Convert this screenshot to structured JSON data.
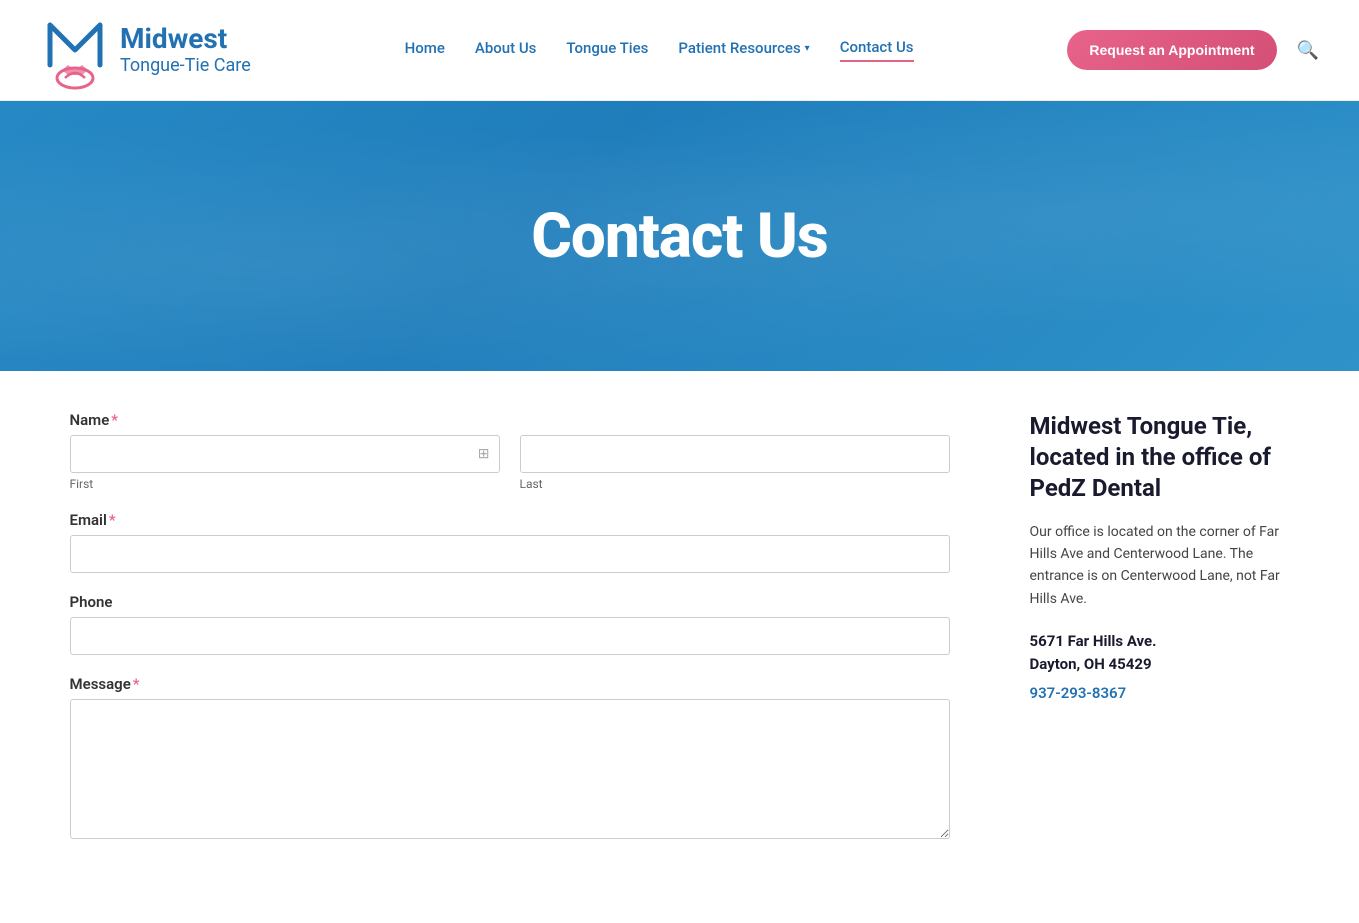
{
  "header": {
    "logo_title": "Midwest",
    "logo_subtitle": "Tongue-Tie Care",
    "request_btn_label": "Request an Appointment",
    "nav": {
      "home": "Home",
      "about_us": "About Us",
      "tongue_ties": "Tongue Ties",
      "patient_resources": "Patient Resources",
      "contact_us": "Contact Us"
    }
  },
  "hero": {
    "title": "Contact Us"
  },
  "form": {
    "name_label": "Name",
    "name_required": "*",
    "first_label": "First",
    "last_label": "Last",
    "email_label": "Email",
    "email_required": "*",
    "phone_label": "Phone",
    "message_label": "Message",
    "message_required": "*"
  },
  "sidebar": {
    "title": "Midwest Tongue Tie, located in the office of PedZ Dental",
    "description": "Our office is located on the corner of Far Hills Ave and Centerwood Lane. The entrance is on Centerwood Lane, not Far Hills Ave.",
    "address_line1": "5671 Far Hills Ave.",
    "address_line2": "Dayton, OH 45429",
    "phone": "937-293-8367"
  },
  "icons": {
    "search": "🔍",
    "chevron_down": "▾",
    "input_handle": "⊞"
  }
}
